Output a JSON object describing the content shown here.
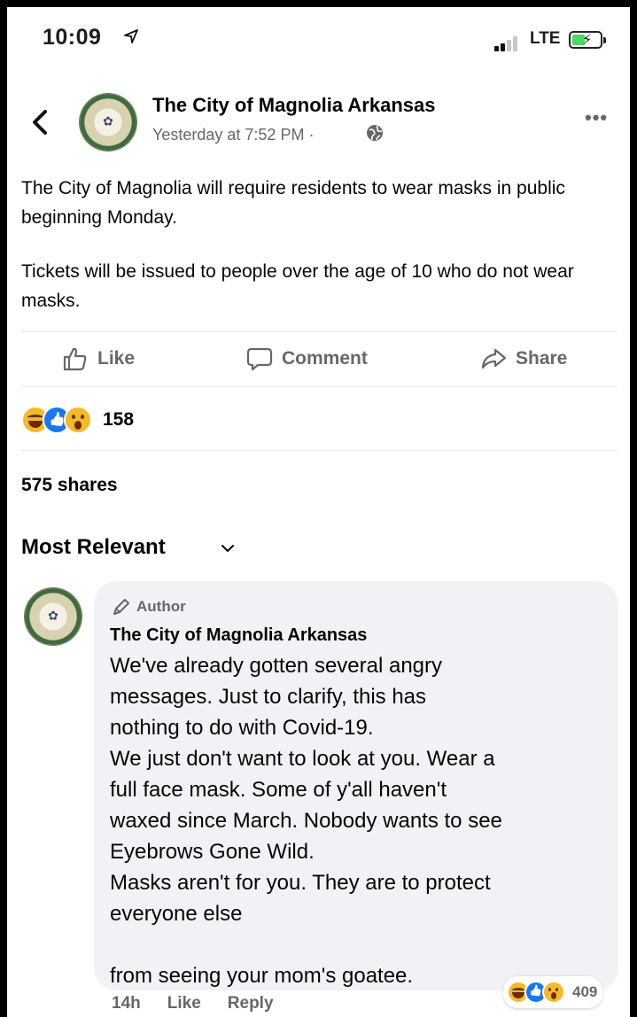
{
  "status_bar": {
    "time": "10:09",
    "network": "LTE",
    "icons": [
      "location-arrow-icon",
      "signal-bars-icon",
      "battery-charging-icon"
    ]
  },
  "post": {
    "page_name": "The City of Magnolia Arkansas",
    "timestamp": "Yesterday at 7:52 PM",
    "separator": "·",
    "audience_icon": "globe-icon",
    "paragraphs": [
      "The City of Magnolia will require residents to wear masks in public beginning Monday.",
      "Tickets will be issued to people over the age of 10 who do not wear masks."
    ]
  },
  "actions": {
    "like": "Like",
    "comment": "Comment",
    "share": "Share"
  },
  "reactions": {
    "types": [
      "haha",
      "like",
      "wow"
    ],
    "count": "158"
  },
  "shares": "575 shares",
  "comments_sort": "Most Relevant",
  "comment": {
    "badge": "Author",
    "author": "The City of Magnolia Arkansas",
    "lines": [
      "We've already gotten several angry",
      "messages. Just to clarify, this has",
      "nothing to do with Covid-19.",
      "We just don't want to look at you. Wear a",
      "full face mask. Some of y'all haven't",
      "waxed since March. Nobody wants to see",
      "Eyebrows Gone Wild.",
      "Masks aren't for you. They are to protect",
      "everyone else",
      "",
      "from seeing your mom's goatee."
    ],
    "age": "14h",
    "like": "Like",
    "reply": "Reply",
    "reaction_count": "409"
  },
  "colors": {
    "text": "#050505",
    "secondary": "#65676b",
    "bubble": "#f0f2f5",
    "like_blue": "#1877f2",
    "emoji_yellow": "#f7b928"
  }
}
